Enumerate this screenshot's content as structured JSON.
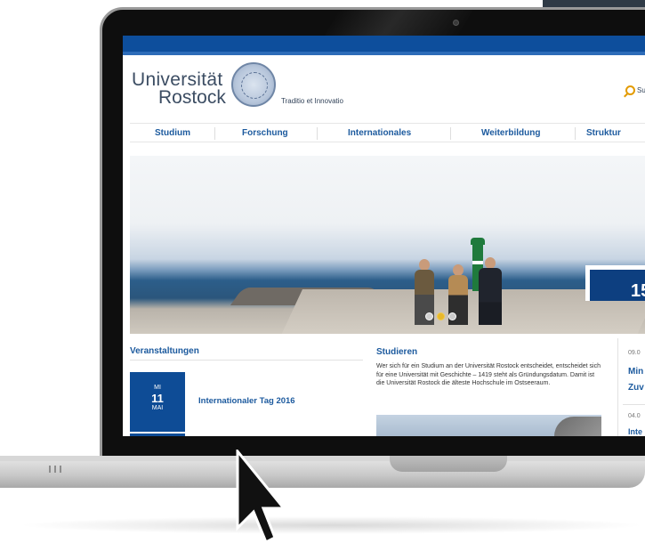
{
  "site": {
    "logo_line1": "Universität",
    "logo_line2": "Rostock",
    "motto": "Traditio et Innovatio",
    "search_label": "Su"
  },
  "nav": {
    "items": [
      {
        "label": "Studium"
      },
      {
        "label": "Forschung"
      },
      {
        "label": "Internationales"
      },
      {
        "label": "Weiterbildung"
      },
      {
        "label": "Struktur"
      }
    ]
  },
  "hero": {
    "badge_text": "15",
    "slider_dots": 3,
    "active_dot": 1
  },
  "events": {
    "title": "Veranstaltungen",
    "date": {
      "dow": "MI",
      "day": "11",
      "month": "MAI"
    },
    "event_title": "Internationaler Tag 2016"
  },
  "study": {
    "title": "Studieren",
    "text": "Wer sich für ein Studium an der Universität Rostock entscheidet, entscheidet sich für eine Universität mit Geschichte – 1419 steht als Gründungsdatum. Damit ist die Universität Rostock die älteste Hochschule im Ostseeraum."
  },
  "sidebar_news": {
    "date1": "09.0",
    "title1_line1": "Min",
    "title1_line2": "Zuv",
    "date2": "04.0",
    "title2": "Inte"
  },
  "colors": {
    "primary_blue": "#0d4e9c",
    "link_blue": "#1c5a9e",
    "search_accent": "#e39b00"
  }
}
